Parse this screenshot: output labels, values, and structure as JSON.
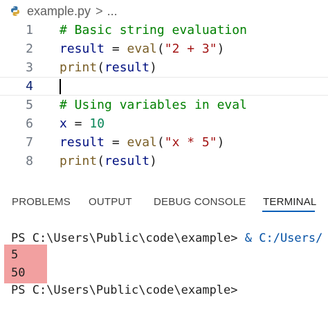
{
  "breadcrumb": {
    "file": "example.py",
    "separator": ">",
    "more": "..."
  },
  "editor": {
    "lines": [
      {
        "number": "1",
        "text": "# Basic string evaluation"
      },
      {
        "number": "2",
        "text": "result = eval(\"2 + 3\")"
      },
      {
        "number": "3",
        "text": "print(result)"
      },
      {
        "number": "4",
        "text": ""
      },
      {
        "number": "5",
        "text": "# Using variables in eval"
      },
      {
        "number": "6",
        "text": "x = 10"
      },
      {
        "number": "7",
        "text": "result = eval(\"x * 5\")"
      },
      {
        "number": "8",
        "text": "print(result)"
      }
    ],
    "current_line": "4"
  },
  "panel": {
    "tabs": [
      {
        "label": "PROBLEMS"
      },
      {
        "label": "OUTPUT"
      },
      {
        "label": "DEBUG CONSOLE"
      },
      {
        "label": "TERMINAL"
      }
    ],
    "active_tab": "TERMINAL"
  },
  "terminal": {
    "command_prompt": "PS C:\\Users\\Public\\code\\example> ",
    "command_text": "& C:/Users/",
    "output_1": "5",
    "output_2": "50",
    "final_prompt": "PS C:\\Users\\Public\\code\\example>"
  },
  "colors": {
    "highlight": "#f2a0a0",
    "active_tab_underline": "#005fb8",
    "comment": "#008000"
  },
  "icons": {
    "file": "python-icon"
  }
}
